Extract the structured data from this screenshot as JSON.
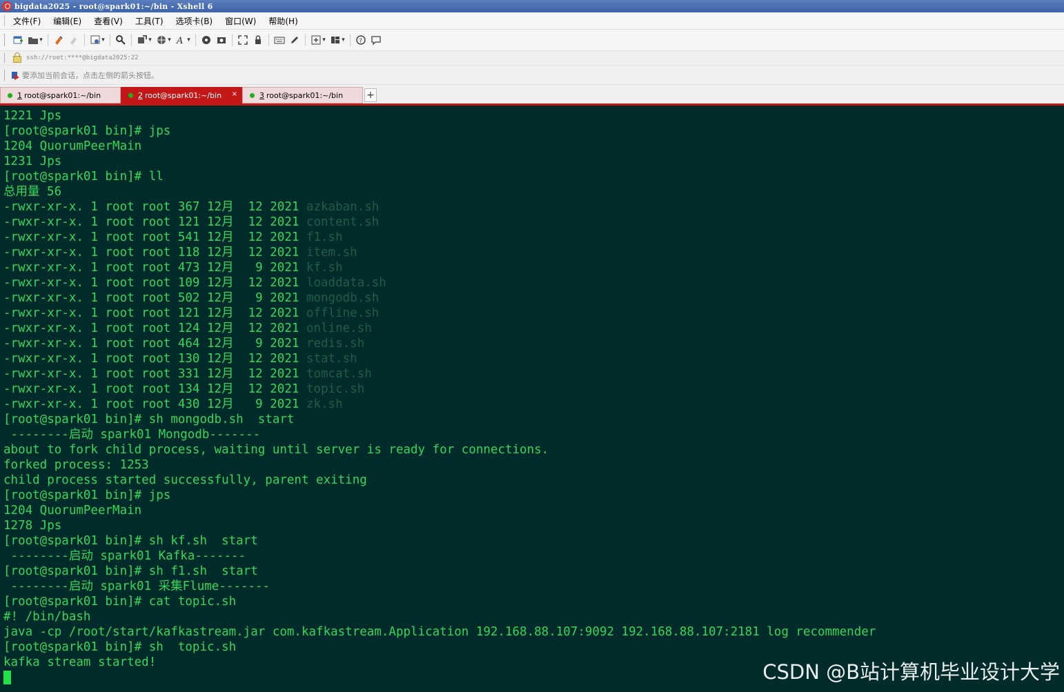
{
  "window": {
    "title": "bigdata2025 - root@spark01:~/bin - Xshell 6"
  },
  "menu": [
    "文件(F)",
    "编辑(E)",
    "查看(V)",
    "工具(T)",
    "选项卡(B)",
    "窗口(W)",
    "帮助(H)"
  ],
  "address": {
    "text": "ssh://root:****@bigdata2025:22"
  },
  "tip": {
    "text": "要添加当前会话，点击左侧的箭头按钮。"
  },
  "tabs": [
    {
      "num": "1",
      "label": "root@spark01:~/bin",
      "active": false
    },
    {
      "num": "2",
      "label": "root@spark01:~/bin",
      "active": true
    },
    {
      "num": "3",
      "label": "root@spark01:~/bin",
      "active": false
    }
  ],
  "terminal": {
    "lines": [
      {
        "text": "1221 Jps"
      },
      {
        "text": "[root@spark01 bin]# jps"
      },
      {
        "text": "1204 QuorumPeerMain"
      },
      {
        "text": "1231 Jps"
      },
      {
        "text": "[root@spark01 bin]# ll"
      },
      {
        "text": "总用量 56"
      },
      {
        "text": "-rwxr-xr-x. 1 root root 367 12月  12 2021 ",
        "file": "azkaban.sh"
      },
      {
        "text": "-rwxr-xr-x. 1 root root 121 12月  12 2021 ",
        "file": "content.sh"
      },
      {
        "text": "-rwxr-xr-x. 1 root root 541 12月  12 2021 ",
        "file": "f1.sh"
      },
      {
        "text": "-rwxr-xr-x. 1 root root 118 12月  12 2021 ",
        "file": "item.sh"
      },
      {
        "text": "-rwxr-xr-x. 1 root root 473 12月   9 2021 ",
        "file": "kf.sh"
      },
      {
        "text": "-rwxr-xr-x. 1 root root 109 12月  12 2021 ",
        "file": "loaddata.sh"
      },
      {
        "text": "-rwxr-xr-x. 1 root root 502 12月   9 2021 ",
        "file": "mongodb.sh"
      },
      {
        "text": "-rwxr-xr-x. 1 root root 121 12月  12 2021 ",
        "file": "offline.sh"
      },
      {
        "text": "-rwxr-xr-x. 1 root root 124 12月  12 2021 ",
        "file": "online.sh"
      },
      {
        "text": "-rwxr-xr-x. 1 root root 464 12月   9 2021 ",
        "file": "redis.sh"
      },
      {
        "text": "-rwxr-xr-x. 1 root root 130 12月  12 2021 ",
        "file": "stat.sh"
      },
      {
        "text": "-rwxr-xr-x. 1 root root 331 12月  12 2021 ",
        "file": "tomcat.sh"
      },
      {
        "text": "-rwxr-xr-x. 1 root root 134 12月  12 2021 ",
        "file": "topic.sh"
      },
      {
        "text": "-rwxr-xr-x. 1 root root 430 12月   9 2021 ",
        "file": "zk.sh"
      },
      {
        "text": "[root@spark01 bin]# sh mongodb.sh  start"
      },
      {
        "text": " --------启动 spark01 Mongodb-------"
      },
      {
        "text": "about to fork child process, waiting until server is ready for connections."
      },
      {
        "text": "forked process: 1253"
      },
      {
        "text": "child process started successfully, parent exiting"
      },
      {
        "text": "[root@spark01 bin]# jps"
      },
      {
        "text": "1204 QuorumPeerMain"
      },
      {
        "text": "1278 Jps"
      },
      {
        "text": "[root@spark01 bin]# sh kf.sh  start"
      },
      {
        "text": " --------启动 spark01 Kafka-------"
      },
      {
        "text": "[root@spark01 bin]# sh f1.sh  start"
      },
      {
        "text": " --------启动 spark01 采集Flume-------"
      },
      {
        "text": "[root@spark01 bin]# cat topic.sh"
      },
      {
        "text": "#! /bin/bash"
      },
      {
        "text": "java -cp /root/start/kafkastream.jar com.kafkastream.Application 192.168.88.107:9092 192.168.88.107:2181 log recommender"
      },
      {
        "text": "[root@spark01 bin]# sh  topic.sh"
      },
      {
        "text": "kafka stream started!"
      }
    ]
  },
  "watermark": "CSDN @B站计算机毕业设计大学",
  "colors": {
    "terminal_bg": "#002b2b",
    "terminal_fg": "#35d65a",
    "file_fg": "#1f5e46",
    "tab_active": "#c41818"
  }
}
